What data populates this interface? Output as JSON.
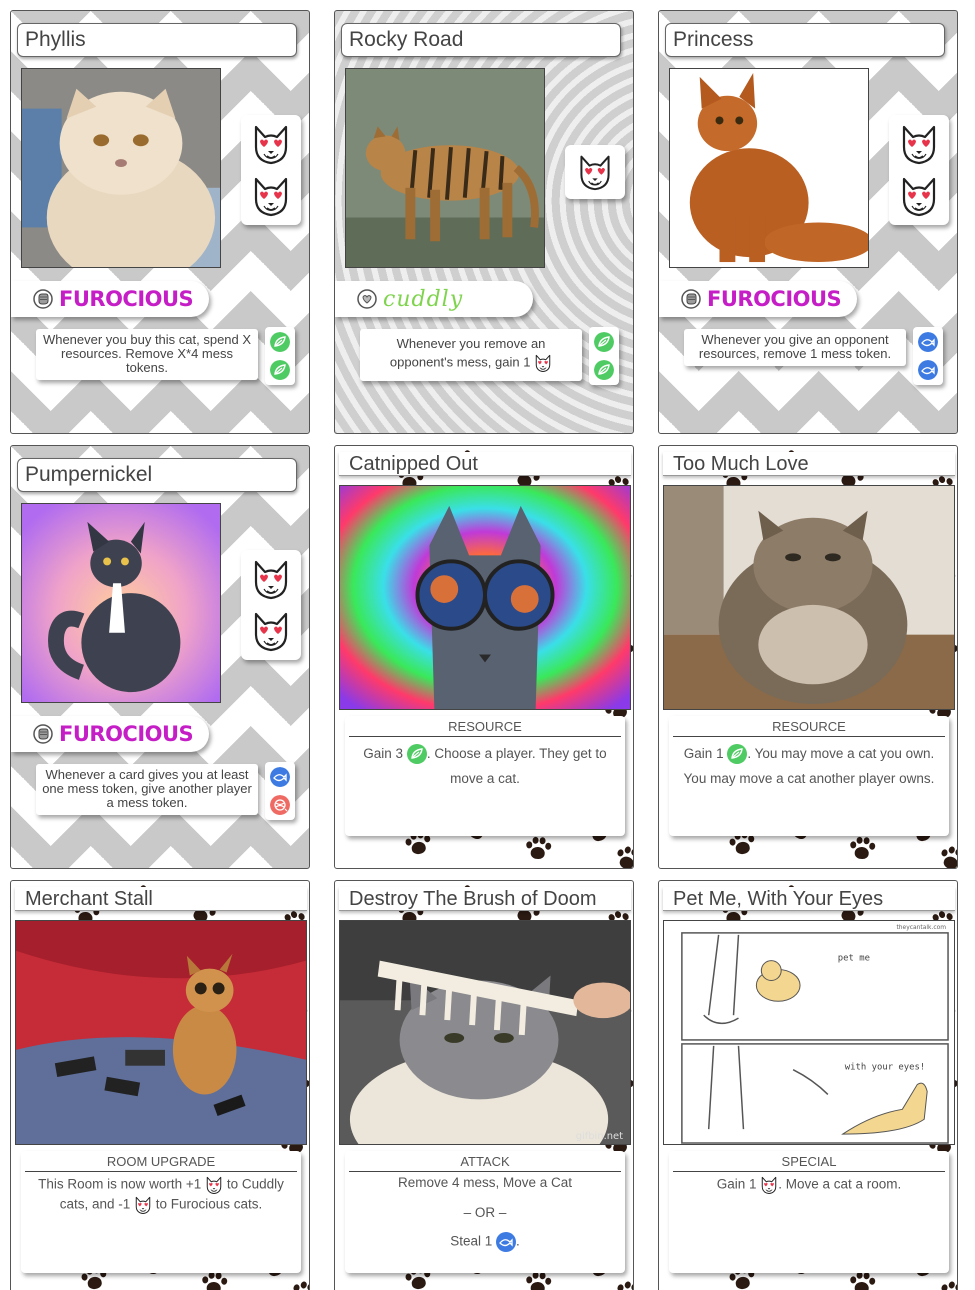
{
  "cards": [
    {
      "name": "Phyllis",
      "hearts": 2,
      "trait": "FUROCIOUS",
      "ability": "Whenever you buy this cat, spend X resources. Remove X*4 mess tokens.",
      "resources": [
        "green-leaf-token",
        "green-leaf-token"
      ]
    },
    {
      "name": "Rocky Road",
      "hearts": 1,
      "trait": "cuddly",
      "ability_part1": "Whenever you remove an opponent's mess, gain 1",
      "resources": [
        "green-leaf-token",
        "green-leaf-token"
      ]
    },
    {
      "name": "Princess",
      "hearts": 2,
      "trait": "FUROCIOUS",
      "ability": "Whenever you give an opponent resources, remove 1 mess token.",
      "resources": [
        "blue-fish-token",
        "blue-fish-token"
      ]
    },
    {
      "name": "Pumpernickel",
      "hearts": 2,
      "trait": "FUROCIOUS",
      "ability": "Whenever a card gives you at least one mess token, give another player a mess token.",
      "resources": [
        "blue-fish-token",
        "red-yarn-token"
      ]
    },
    {
      "name": "Catnipped Out",
      "type": "RESOURCE",
      "text_part1": "Gain 3",
      "text_part2": ". Choose a player. They get to move a cat."
    },
    {
      "name": "Too Much Love",
      "type": "RESOURCE",
      "text_part1": "Gain 1",
      "text_part2": ". You may move a cat you own. You may move a cat another player owns."
    },
    {
      "name": "Merchant Stall",
      "type": "ROOM UPGRADE",
      "text_part1": "This Room is now worth +1",
      "text_part2": "to Cuddly cats, and -1",
      "text_part3": "to Furocious cats."
    },
    {
      "name": "Destroy The Brush of Doom",
      "type": "ATTACK",
      "line1": "Remove 4 mess, Move a Cat",
      "line2": "– OR –",
      "line3_part1": "Steal 1",
      "line3_part2": "."
    },
    {
      "name": "Pet Me, With Your Eyes",
      "type": "SPECIAL",
      "text_part1": "Gain 1",
      "text_part2": ". Move a cat a room.",
      "comic_caption1": "pet me",
      "comic_caption2": "with your eyes!",
      "comic_credit": "theycantalk.com"
    }
  ],
  "watermark": "gifbin.net",
  "colors": {
    "furious": "#c51ec7",
    "cuddly": "#7fd44e",
    "leaf": "#4fcb63",
    "fish": "#3d7be3",
    "yarn": "#ee6a63",
    "heart": "#e8344a"
  }
}
